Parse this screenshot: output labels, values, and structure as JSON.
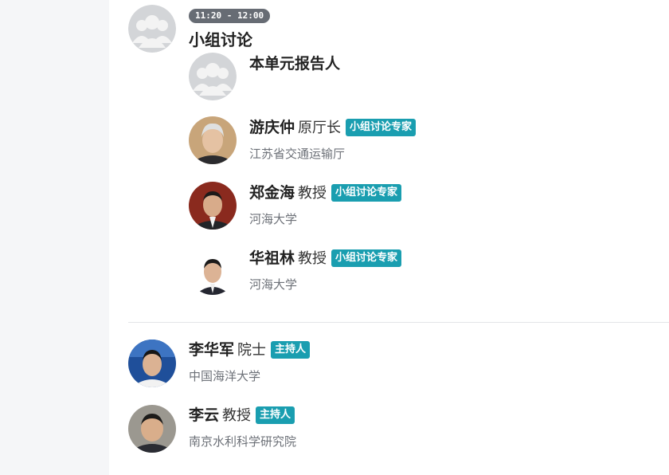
{
  "session": {
    "time": "11:20 - 12:00",
    "title": "小组讨论"
  },
  "speakers": [
    {
      "name": "本单元报告人",
      "title": "",
      "tag": "",
      "org": "",
      "avatar": "placeholder-avatar"
    },
    {
      "name": "游庆仲",
      "title": "原厅长",
      "tag": "小组讨论专家",
      "org": "江苏省交通运输厅",
      "avatar": "portrait-photo"
    },
    {
      "name": "郑金海",
      "title": "教授",
      "tag": "小组讨论专家",
      "org": "河海大学",
      "avatar": "portrait-photo"
    },
    {
      "name": "华祖林",
      "title": "教授",
      "tag": "小组讨论专家",
      "org": "河海大学",
      "avatar": "portrait-photo"
    }
  ],
  "hosts": [
    {
      "name": "李华军",
      "title": "院士",
      "tag": "主持人",
      "org": "中国海洋大学",
      "avatar": "portrait-photo"
    },
    {
      "name": "李云",
      "title": "教授",
      "tag": "主持人",
      "org": "南京水利科学研究院",
      "avatar": "portrait-photo"
    }
  ],
  "colors": {
    "tag_bg": "#1a9eb0",
    "time_badge_bg": "#676c74",
    "left_strip_bg": "#f5f6f8",
    "divider": "#e3e5e8"
  }
}
